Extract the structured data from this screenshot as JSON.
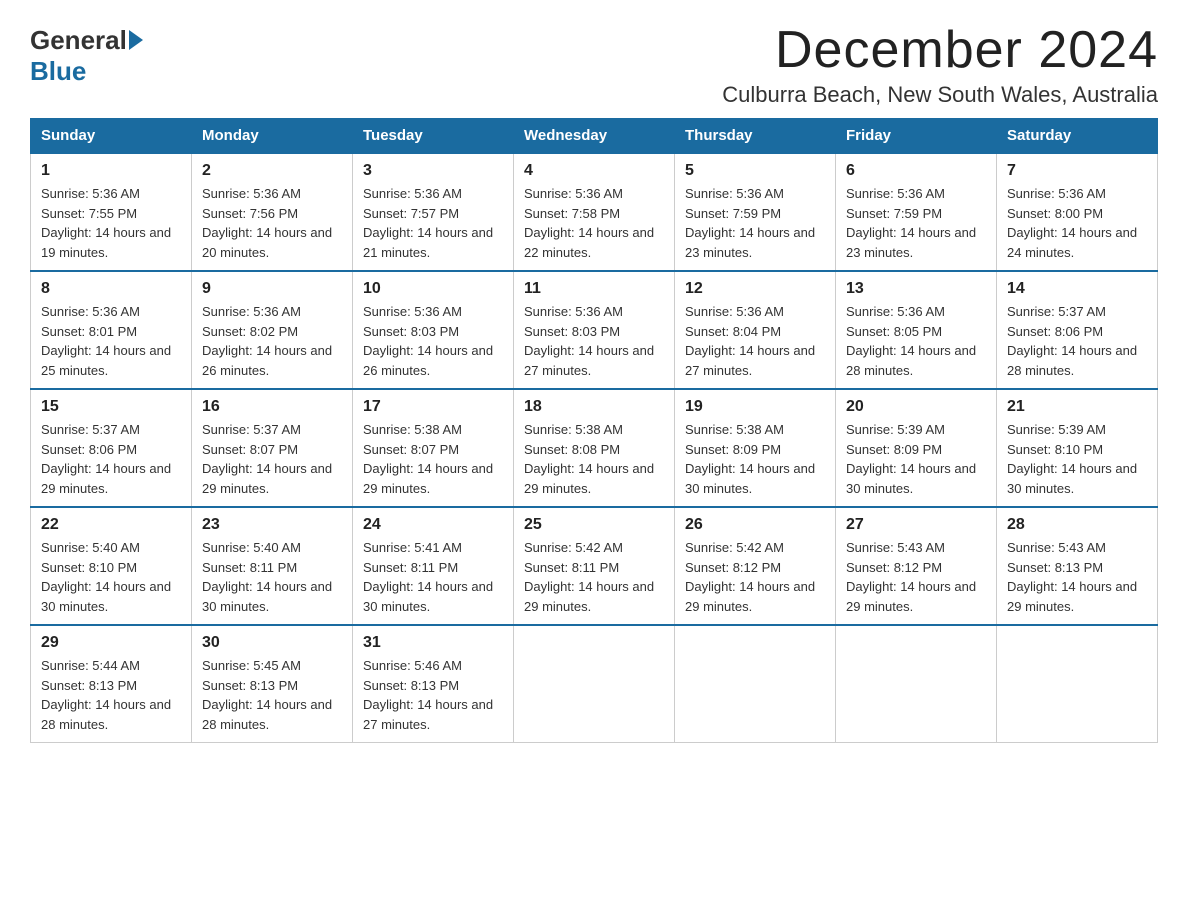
{
  "logo": {
    "general": "General",
    "blue": "Blue"
  },
  "title": "December 2024",
  "subtitle": "Culburra Beach, New South Wales, Australia",
  "days_of_week": [
    "Sunday",
    "Monday",
    "Tuesday",
    "Wednesday",
    "Thursday",
    "Friday",
    "Saturday"
  ],
  "weeks": [
    [
      {
        "day": "1",
        "sunrise": "5:36 AM",
        "sunset": "7:55 PM",
        "daylight": "14 hours and 19 minutes."
      },
      {
        "day": "2",
        "sunrise": "5:36 AM",
        "sunset": "7:56 PM",
        "daylight": "14 hours and 20 minutes."
      },
      {
        "day": "3",
        "sunrise": "5:36 AM",
        "sunset": "7:57 PM",
        "daylight": "14 hours and 21 minutes."
      },
      {
        "day": "4",
        "sunrise": "5:36 AM",
        "sunset": "7:58 PM",
        "daylight": "14 hours and 22 minutes."
      },
      {
        "day": "5",
        "sunrise": "5:36 AM",
        "sunset": "7:59 PM",
        "daylight": "14 hours and 23 minutes."
      },
      {
        "day": "6",
        "sunrise": "5:36 AM",
        "sunset": "7:59 PM",
        "daylight": "14 hours and 23 minutes."
      },
      {
        "day": "7",
        "sunrise": "5:36 AM",
        "sunset": "8:00 PM",
        "daylight": "14 hours and 24 minutes."
      }
    ],
    [
      {
        "day": "8",
        "sunrise": "5:36 AM",
        "sunset": "8:01 PM",
        "daylight": "14 hours and 25 minutes."
      },
      {
        "day": "9",
        "sunrise": "5:36 AM",
        "sunset": "8:02 PM",
        "daylight": "14 hours and 26 minutes."
      },
      {
        "day": "10",
        "sunrise": "5:36 AM",
        "sunset": "8:03 PM",
        "daylight": "14 hours and 26 minutes."
      },
      {
        "day": "11",
        "sunrise": "5:36 AM",
        "sunset": "8:03 PM",
        "daylight": "14 hours and 27 minutes."
      },
      {
        "day": "12",
        "sunrise": "5:36 AM",
        "sunset": "8:04 PM",
        "daylight": "14 hours and 27 minutes."
      },
      {
        "day": "13",
        "sunrise": "5:36 AM",
        "sunset": "8:05 PM",
        "daylight": "14 hours and 28 minutes."
      },
      {
        "day": "14",
        "sunrise": "5:37 AM",
        "sunset": "8:06 PM",
        "daylight": "14 hours and 28 minutes."
      }
    ],
    [
      {
        "day": "15",
        "sunrise": "5:37 AM",
        "sunset": "8:06 PM",
        "daylight": "14 hours and 29 minutes."
      },
      {
        "day": "16",
        "sunrise": "5:37 AM",
        "sunset": "8:07 PM",
        "daylight": "14 hours and 29 minutes."
      },
      {
        "day": "17",
        "sunrise": "5:38 AM",
        "sunset": "8:07 PM",
        "daylight": "14 hours and 29 minutes."
      },
      {
        "day": "18",
        "sunrise": "5:38 AM",
        "sunset": "8:08 PM",
        "daylight": "14 hours and 29 minutes."
      },
      {
        "day": "19",
        "sunrise": "5:38 AM",
        "sunset": "8:09 PM",
        "daylight": "14 hours and 30 minutes."
      },
      {
        "day": "20",
        "sunrise": "5:39 AM",
        "sunset": "8:09 PM",
        "daylight": "14 hours and 30 minutes."
      },
      {
        "day": "21",
        "sunrise": "5:39 AM",
        "sunset": "8:10 PM",
        "daylight": "14 hours and 30 minutes."
      }
    ],
    [
      {
        "day": "22",
        "sunrise": "5:40 AM",
        "sunset": "8:10 PM",
        "daylight": "14 hours and 30 minutes."
      },
      {
        "day": "23",
        "sunrise": "5:40 AM",
        "sunset": "8:11 PM",
        "daylight": "14 hours and 30 minutes."
      },
      {
        "day": "24",
        "sunrise": "5:41 AM",
        "sunset": "8:11 PM",
        "daylight": "14 hours and 30 minutes."
      },
      {
        "day": "25",
        "sunrise": "5:42 AM",
        "sunset": "8:11 PM",
        "daylight": "14 hours and 29 minutes."
      },
      {
        "day": "26",
        "sunrise": "5:42 AM",
        "sunset": "8:12 PM",
        "daylight": "14 hours and 29 minutes."
      },
      {
        "day": "27",
        "sunrise": "5:43 AM",
        "sunset": "8:12 PM",
        "daylight": "14 hours and 29 minutes."
      },
      {
        "day": "28",
        "sunrise": "5:43 AM",
        "sunset": "8:13 PM",
        "daylight": "14 hours and 29 minutes."
      }
    ],
    [
      {
        "day": "29",
        "sunrise": "5:44 AM",
        "sunset": "8:13 PM",
        "daylight": "14 hours and 28 minutes."
      },
      {
        "day": "30",
        "sunrise": "5:45 AM",
        "sunset": "8:13 PM",
        "daylight": "14 hours and 28 minutes."
      },
      {
        "day": "31",
        "sunrise": "5:46 AM",
        "sunset": "8:13 PM",
        "daylight": "14 hours and 27 minutes."
      },
      null,
      null,
      null,
      null
    ]
  ]
}
